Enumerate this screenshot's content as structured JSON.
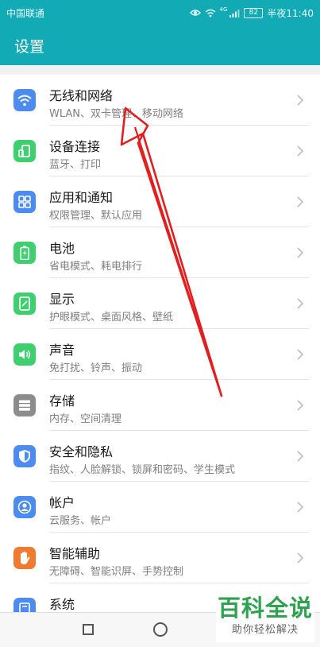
{
  "status_bar": {
    "carrier": "中国联通",
    "battery": "82",
    "time": "半夜11:40",
    "network_badge": "4G"
  },
  "header": {
    "title": "设置"
  },
  "settings": [
    {
      "title": "无线和网络",
      "subtitle": "WLAN、双卡管理、移动网络",
      "icon": "wifi-icon",
      "color": "#4c8cf0"
    },
    {
      "title": "设备连接",
      "subtitle": "蓝牙、打印",
      "icon": "device-connection-icon",
      "color": "#3ecf6e"
    },
    {
      "title": "应用和通知",
      "subtitle": "权限管理、默认应用",
      "icon": "apps-icon",
      "color": "#4c8cf0"
    },
    {
      "title": "电池",
      "subtitle": "省电模式、耗电排行",
      "icon": "battery-icon",
      "color": "#3ecf6e"
    },
    {
      "title": "显示",
      "subtitle": "护眼模式、桌面风格、壁纸",
      "icon": "display-icon",
      "color": "#3ecf6e"
    },
    {
      "title": "声音",
      "subtitle": "免打扰、铃声、振动",
      "icon": "sound-icon",
      "color": "#3ecf6e"
    },
    {
      "title": "存储",
      "subtitle": "内存、空间清理",
      "icon": "storage-icon",
      "color": "#8c8c8c"
    },
    {
      "title": "安全和隐私",
      "subtitle": "指纹、人脸解锁、锁屏和密码、学生模式",
      "icon": "shield-icon",
      "color": "#4c8cf0"
    },
    {
      "title": "帐户",
      "subtitle": "云服务、帐户",
      "icon": "account-icon",
      "color": "#4c8cf0"
    },
    {
      "title": "智能辅助",
      "subtitle": "无障碍、智能识屏、手势控制",
      "icon": "hand-icon",
      "color": "#f07a30"
    },
    {
      "title": "系统",
      "subtitle": "",
      "icon": "system-icon",
      "color": "#4c8cf0"
    }
  ],
  "watermark": {
    "main": "百科全说",
    "sub": "助你轻松解决"
  },
  "colors": {
    "accent": "#12aab5",
    "annotation": "#e02020"
  }
}
